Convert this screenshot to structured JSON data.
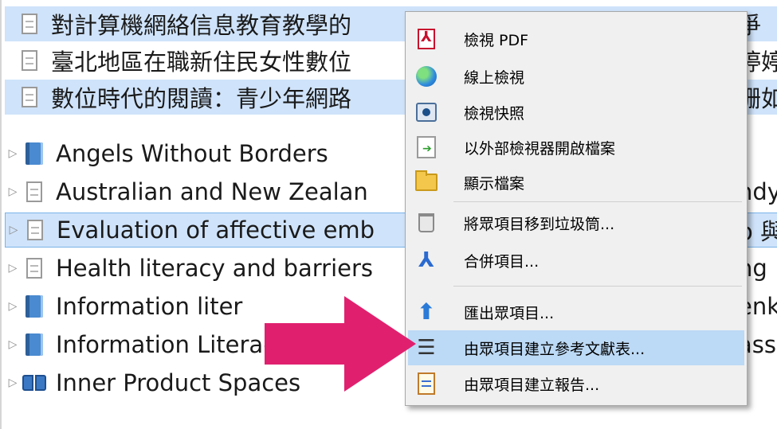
{
  "list": {
    "items": [
      {
        "title": "對計算機網絡信息教育教學的",
        "after": "爭",
        "icon": "document-icon",
        "indent": true,
        "selected": true,
        "focused": false,
        "expander": false
      },
      {
        "title": "臺北地區在職新住民女性數位",
        "after": "婷婷",
        "icon": "document-icon",
        "indent": true,
        "selected": false,
        "focused": false,
        "expander": false
      },
      {
        "title": "數位時代的閱讀：青少年網路",
        "after": "珊如",
        "icon": "document-icon",
        "indent": true,
        "selected": true,
        "focused": false,
        "expander": false
      },
      {
        "title": "Angels Without Borders",
        "after": "",
        "icon": "book-icon",
        "indent": false,
        "selected": false,
        "focused": false,
        "expander": true
      },
      {
        "title": "Australian and New Zealan",
        "after": "ndy",
        "icon": "document-icon",
        "indent": false,
        "selected": false,
        "focused": false,
        "expander": true
      },
      {
        "title": "Evaluation of affective emb",
        "after": "o 與",
        "icon": "document-icon",
        "indent": false,
        "selected": true,
        "focused": true,
        "expander": true
      },
      {
        "title": "Health literacy and barriers",
        "after": "ng",
        "icon": "document-icon",
        "indent": false,
        "selected": false,
        "focused": false,
        "expander": true
      },
      {
        "title": "Information liter",
        "after": "enk",
        "icon": "book-icon",
        "indent": false,
        "selected": false,
        "focused": false,
        "expander": true
      },
      {
        "title": "Information Literacy Instruc",
        "after": "ass",
        "icon": "book-icon",
        "indent": false,
        "selected": false,
        "focused": false,
        "expander": true
      },
      {
        "title": "Inner Product Spaces",
        "after": "",
        "icon": "open-book-icon",
        "indent": false,
        "selected": false,
        "focused": false,
        "expander": true
      }
    ]
  },
  "context_menu": {
    "items": [
      {
        "label": "檢視 PDF",
        "icon": "pdf-icon",
        "highlighted": false
      },
      {
        "label": "線上檢視",
        "icon": "globe-icon",
        "highlighted": false
      },
      {
        "label": "檢視快照",
        "icon": "camera-icon",
        "highlighted": false
      },
      {
        "label": "以外部檢視器開啟檔案",
        "icon": "external-open-icon",
        "highlighted": false
      },
      {
        "label": "顯示檔案",
        "icon": "folder-icon",
        "highlighted": false
      },
      {
        "separator": true
      },
      {
        "label": "將眾項目移到垃圾筒...",
        "icon": "trash-icon",
        "highlighted": false
      },
      {
        "label": "合併項目...",
        "icon": "merge-icon",
        "highlighted": false
      },
      {
        "separator": true
      },
      {
        "label": "匯出眾項目...",
        "icon": "export-icon",
        "highlighted": false
      },
      {
        "label": "由眾項目建立參考文獻表...",
        "icon": "bibliography-icon",
        "highlighted": true
      },
      {
        "label": "由眾項目建立報告...",
        "icon": "report-icon",
        "highlighted": false
      }
    ]
  },
  "colors": {
    "selection": "#cfe3fa",
    "menu_highlight": "#bcd9f5",
    "arrow": "#e0206f"
  }
}
